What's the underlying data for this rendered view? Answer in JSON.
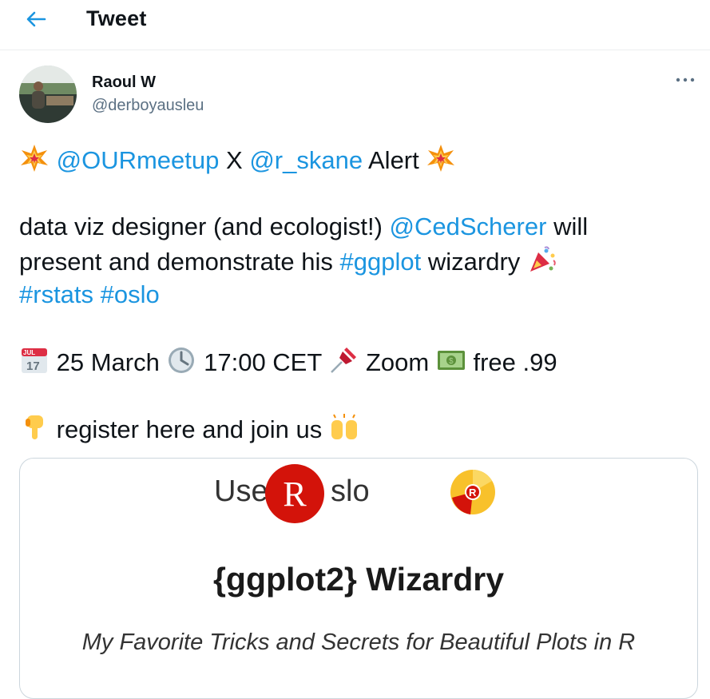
{
  "header": {
    "title": "Tweet",
    "back_icon": "arrow-left-icon"
  },
  "author": {
    "name": "Raoul W",
    "handle": "@derboyausleu"
  },
  "tweet": {
    "line1": {
      "m1": "@OURmeetup",
      "x": "X",
      "m2": "@r_skane",
      "alert": "Alert"
    },
    "line2": {
      "t1": "data viz designer (and ecologist!)",
      "m1": "@CedScherer",
      "t2": "will"
    },
    "line3": {
      "t1": "present and demonstrate his",
      "h1": "#ggplot",
      "t2": "wizardry"
    },
    "line4": {
      "h1": "#rstats",
      "h2": "#oslo"
    },
    "line5": {
      "date": "25 March",
      "time": "17:00 CET",
      "place": "Zoom",
      "price": "free .99",
      "cal_month": "JUL",
      "cal_day": "17"
    },
    "line6": {
      "text": "register here and join us"
    }
  },
  "card": {
    "logo_use": "Use",
    "logo_r": "R",
    "logo_slo": "slo",
    "title": "{ggplot2} Wizardry",
    "subtitle": "My Favorite Tricks and Secrets for Beautiful Plots in R"
  },
  "colors": {
    "link": "#1b95e0",
    "handle": "#5b7083",
    "r_red": "#d3130a",
    "r_yellow": "#f8c12b"
  }
}
